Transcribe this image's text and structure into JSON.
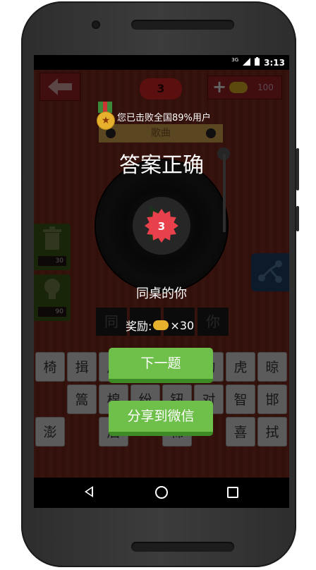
{
  "status_bar": {
    "network": "3G",
    "time": "3:13"
  },
  "header": {
    "level": "3",
    "coins": "100"
  },
  "notice": {
    "text": "您已击败全国89%用户"
  },
  "category": {
    "label": "歌曲"
  },
  "result": {
    "title": "答案正确",
    "badge_number": "3",
    "song_name": "同桌的你"
  },
  "answer_slots": [
    "同",
    "",
    "",
    "你"
  ],
  "reward": {
    "label": "奖励:",
    "amount": "×30"
  },
  "side_tools": {
    "delete_cost": "30",
    "hint_cost": "90"
  },
  "keys": [
    {
      "char": "椅"
    },
    {
      "char": "揖"
    },
    {
      "char": "后"
    },
    {
      "char": ""
    },
    {
      "char": ""
    },
    {
      "char": "的"
    },
    {
      "char": "虎"
    },
    {
      "char": "晾"
    },
    {
      "char": "篙"
    },
    {
      "char": "棉"
    },
    {
      "char": "纷"
    },
    {
      "char": "钮"
    },
    {
      "char": "对"
    },
    {
      "char": "智"
    },
    {
      "char": "邯"
    },
    {
      "char": "澎"
    },
    {
      "char": "后"
    },
    {
      "char": "棉"
    },
    {
      "char": "喜"
    },
    {
      "char": "拭"
    }
  ],
  "buttons": {
    "next": "下一题",
    "share": "分享到微信"
  },
  "colors": {
    "accent_green": "#6fbf4b",
    "badge_red": "#e8414c",
    "coin_gold": "#e6b12d"
  }
}
